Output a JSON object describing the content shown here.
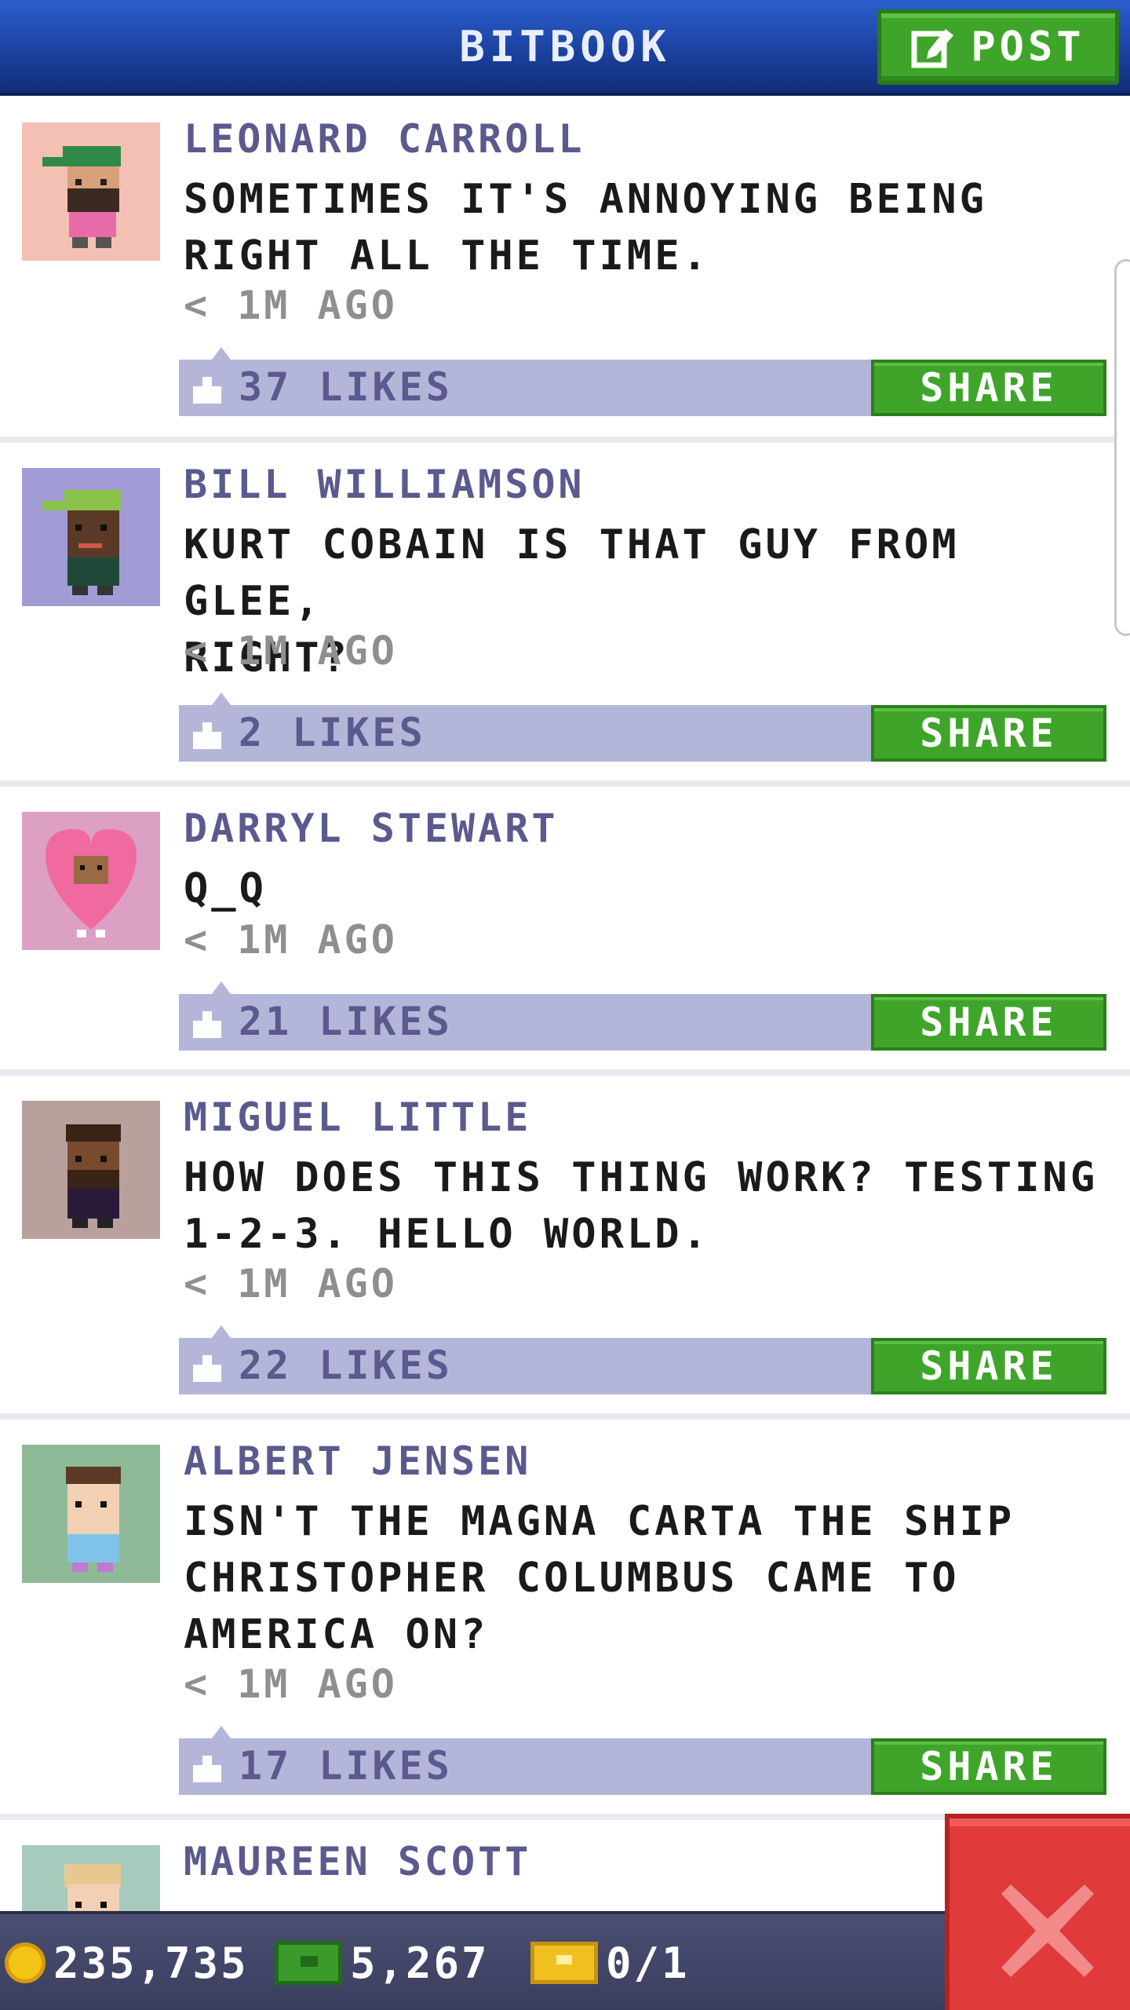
{
  "header": {
    "title": "BITBOOK",
    "post_label": "POST"
  },
  "posts": [
    {
      "author": "LEONARD CARROLL",
      "text": "SOMETIMES IT'S ANNOYING BEING\nRIGHT ALL THE TIME.",
      "time": "< 1M AGO",
      "likes": "37 LIKES",
      "share": "SHARE",
      "avatar_bg": "#f4c0b4"
    },
    {
      "author": "BILL WILLIAMSON",
      "text": "KURT COBAIN IS THAT GUY FROM GLEE,\nRIGHT?",
      "time": "< 1M AGO",
      "likes": "2 LIKES",
      "share": "SHARE",
      "avatar_bg": "#a19cd6"
    },
    {
      "author": "DARRYL STEWART",
      "text": "Q_Q",
      "time": "< 1M AGO",
      "likes": "21 LIKES",
      "share": "SHARE",
      "avatar_bg": "#dca0c4"
    },
    {
      "author": "MIGUEL LITTLE",
      "text": "HOW DOES THIS THING WORK? TESTING\n1-2-3. HELLO WORLD.",
      "time": "< 1M AGO",
      "likes": "22 LIKES",
      "share": "SHARE",
      "avatar_bg": "#b9a09c"
    },
    {
      "author": "ALBERT JENSEN",
      "text": "ISN'T THE MAGNA CARTA THE SHIP\nCHRISTOPHER COLUMBUS CAME TO\nAMERICA ON?",
      "time": "< 1M AGO",
      "likes": "17 LIKES",
      "share": "SHARE",
      "avatar_bg": "#8fba98"
    },
    {
      "author": "MAUREEN SCOTT",
      "text": "",
      "time": "",
      "likes": "",
      "share": "",
      "avatar_bg": "#a6cbbd"
    }
  ],
  "bottom_bar": {
    "coins": "235,735",
    "bux": "5,267",
    "tickets": "0/1"
  },
  "icons": {
    "post": "edit-icon",
    "like": "thumbs-up-icon",
    "coins": "coin-icon",
    "bux": "bux-icon",
    "tickets": "ticket-icon",
    "close": "close-icon"
  },
  "colors": {
    "header": "#1a3f9c",
    "green_button": "#3fa52a",
    "likes_bar": "#b4b6d9",
    "author": "#5b5a8e",
    "close_button": "#e03a3a"
  }
}
